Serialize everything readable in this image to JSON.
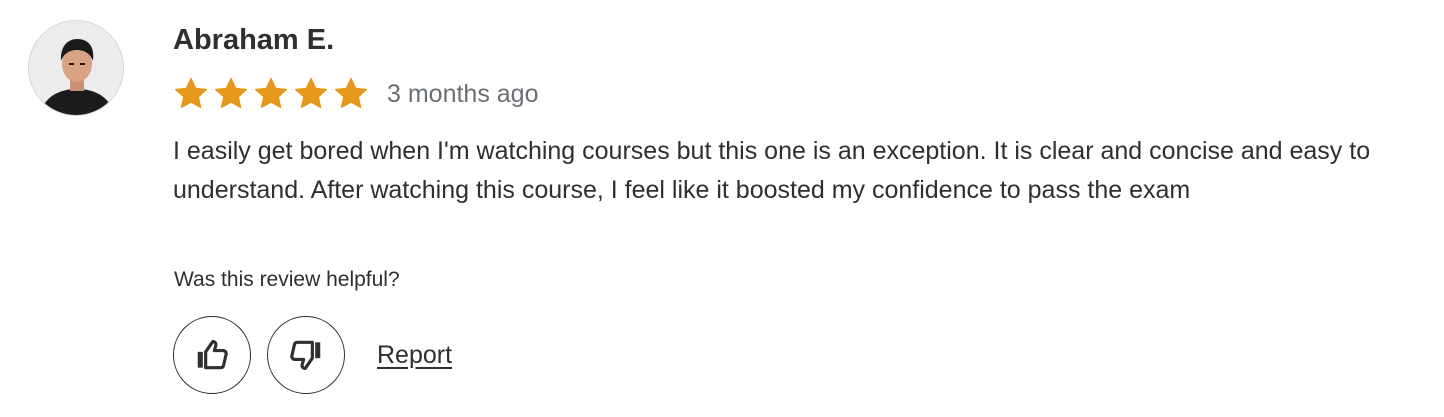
{
  "review": {
    "author_name": "Abraham E.",
    "rating": 5,
    "rating_max": 5,
    "date": "3 months ago",
    "text": "I easily get bored when I'm watching courses but this one is an exception. It is clear and concise and easy to understand. After watching this course, I feel like it boosted my confidence to pass the exam",
    "helpful_prompt": "Was this review helpful?",
    "report_label": "Report"
  },
  "icons": {
    "star": "star-icon",
    "thumbs_up": "thumbs-up-icon",
    "thumbs_down": "thumbs-down-icon",
    "avatar": "avatar-photo"
  },
  "colors": {
    "star": "#e59819",
    "text": "#2d2f31",
    "muted": "#6a6f73"
  }
}
